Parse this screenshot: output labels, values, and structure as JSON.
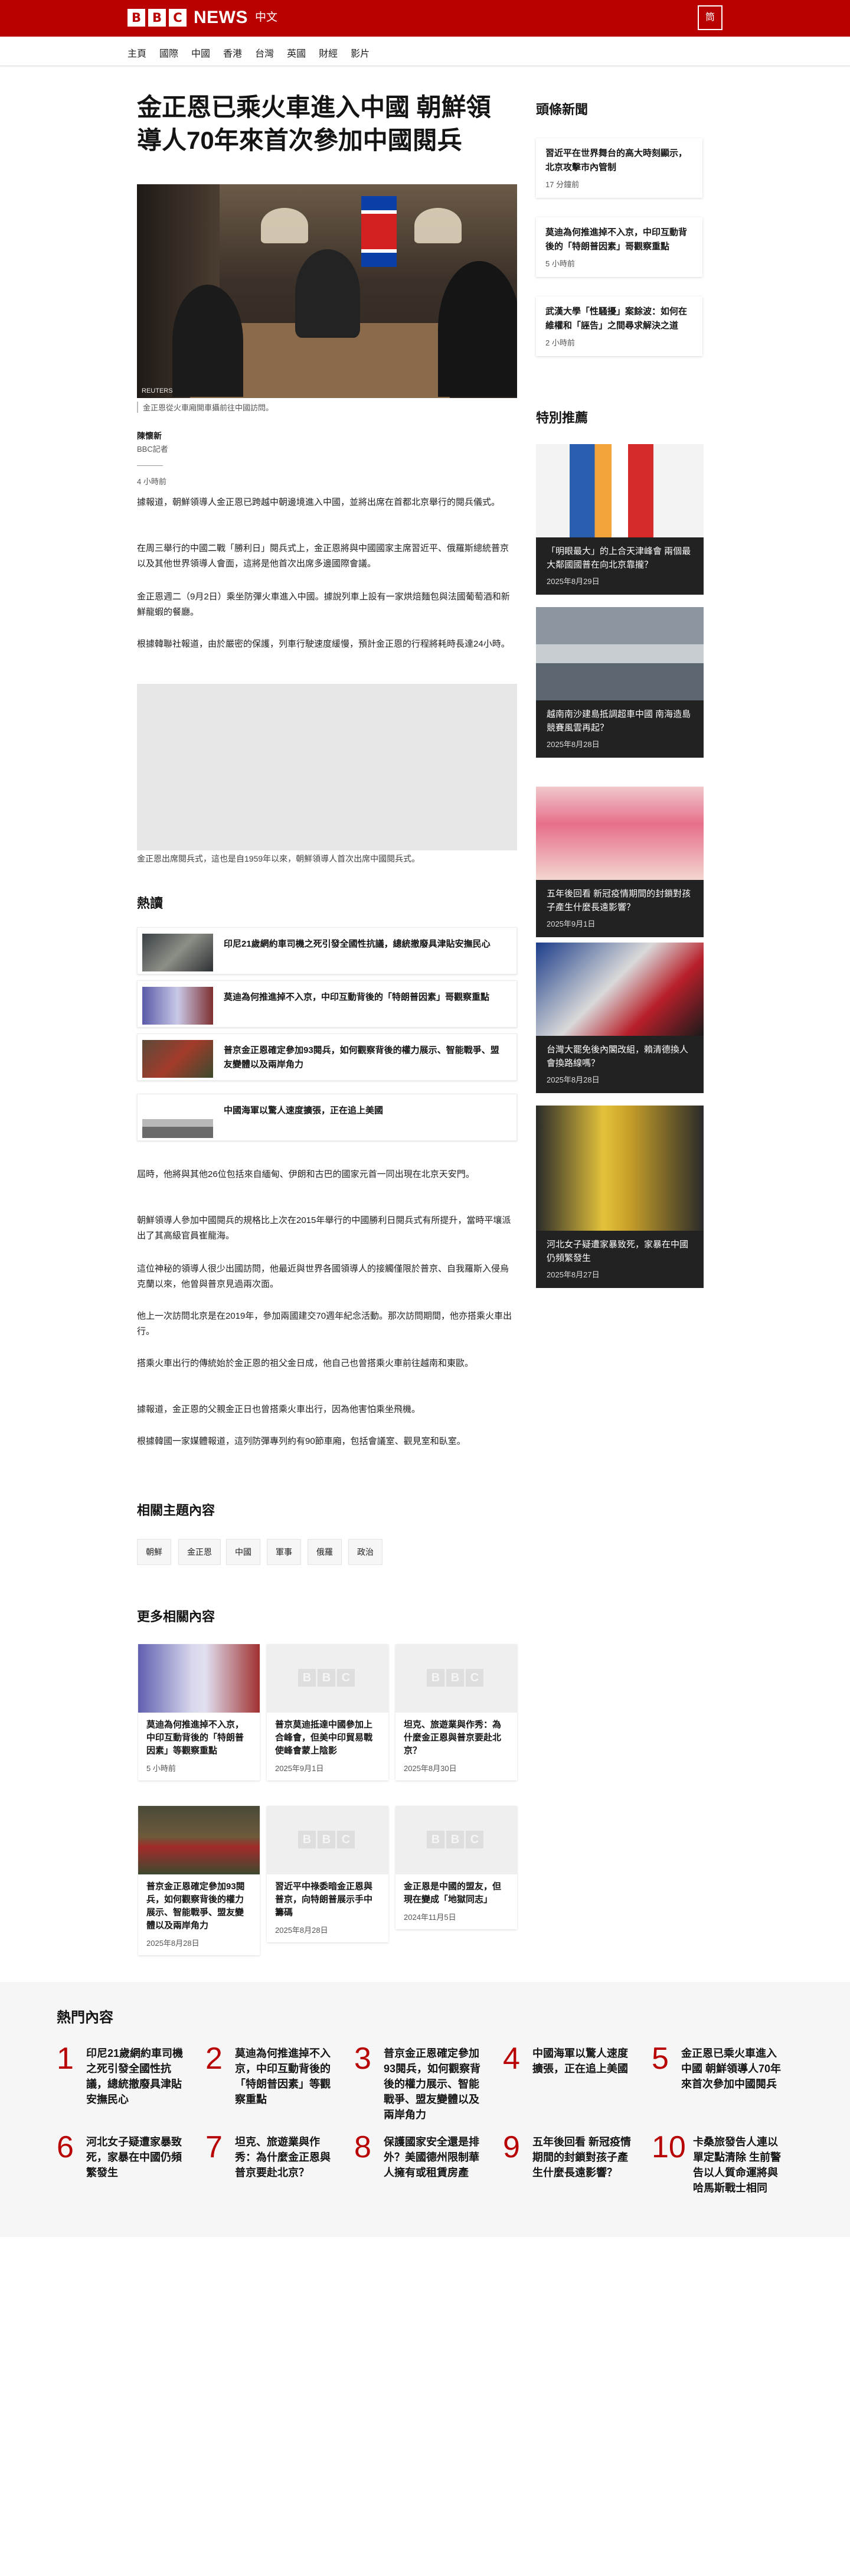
{
  "header": {
    "logo_letters": [
      "B",
      "B",
      "C"
    ],
    "brand": "NEWS",
    "lang": "中文",
    "menu_label": "筒"
  },
  "nav": {
    "items": [
      "主頁",
      "國際",
      "中國",
      "香港",
      "台灣",
      "英國",
      "財經",
      "影片"
    ]
  },
  "article": {
    "title": "金正恩已乘火車進入中國 朝鮮領導人70年來首次參加中國閱兵",
    "image_credit": "REUTERS",
    "image_caption": "金正恩從火車廂開車攝前往中國訪問。",
    "author": "陳懷新",
    "role": "BBC記者",
    "time": "4 小時前",
    "paras_top": [
      "據報道，朝鮮領導人金正恩已跨越中朝邊境進入中國，並將出席在首都北京舉行的閱兵儀式。",
      "在周三舉行的中國二戰「勝利日」閱兵式上，金正恩將與中國國家主席習近平、俄羅斯總統普京以及其他世界領導人會面，這將是他首次出席多邊國際會議。",
      "金正恩週二（9月2日）乘坐防彈火車進入中國。據說列車上設有一家烘焙麵包與法國葡萄酒和新鮮龍蝦的餐廳。",
      "根據韓聯社報道，由於嚴密的保護，列車行駛速度緩慢，預計金正恩的行程將耗時長達24小時。"
    ],
    "media_caption": "金正恩出席閱兵式，這也是自1959年以來，朝鮮領導人首次出席中國閱兵式。",
    "paras_bottom": [
      "屆時，他將與其他26位包括來自緬甸、伊朗和古巴的國家元首一同出現在北京天安門。",
      "朝鮮領導人參加中國閱兵的規格比上次在2015年舉行的中國勝利日閱兵式有所提升，當時平壤派出了其高級官員崔龍海。",
      "這位神秘的領導人很少出國訪問，他最近與世界各國領導人的接觸僅限於普京、自我羅斯入侵烏克蘭以來，他曾與普京見過兩次面。",
      "他上一次訪問北京是在2019年，參加兩國建交70週年紀念活動。那次訪問期間，他亦搭乘火車出行。",
      "搭乘火車出行的傳統始於金正恩的祖父金日成，他自己也曾搭乘火車前往越南和東歐。",
      "據報道，金正恩的父親金正日也曾搭乘火車出行，因為他害怕乘坐飛機。",
      "根據韓國一家媒體報道，這列防彈專列約有90節車廂，包括會議室、觀見室和臥室。"
    ]
  },
  "hot_section": {
    "heading": "熱讀",
    "items": [
      "印尼21歲網約車司機之死引發全國性抗議，總統撤廢具津貼安撫民心",
      "莫迪為何推進掉不入京，中印互動背後的「特朗普因素」哥觀察重點",
      "普京金正恩確定參加93閱兵，如何觀察背後的權力展示、智能戰爭、盟友變體以及兩岸角力",
      "中國海軍以驚人速度擴張，正在追上美國"
    ]
  },
  "topics": {
    "heading": "相關主題內容",
    "tags": [
      "朝鮮",
      "金正恩",
      "中國",
      "軍事",
      "俄羅",
      "政治"
    ]
  },
  "more": {
    "heading": "更多相關內容",
    "cards": [
      {
        "title": "莫迪為何推進掉不入京，中印互動背後的「特朗普因素」等觀察重點",
        "date": "5 小時前"
      },
      {
        "title": "普京莫迪抵達中國參加上合峰會，但美中印貿易戰使峰會蒙上陰影",
        "date": "2025年9月1日"
      },
      {
        "title": "坦克、旅遊業與作秀：為什麼金正恩與普京要赴北京？",
        "date": "2025年8月30日"
      },
      {
        "title": "普京金正恩確定參加93閱兵，如何觀察背後的權力展示、智能戰爭、盟友變體以及兩岸角力",
        "date": "2025年8月28日"
      },
      {
        "title": "習近平中祿委暗金正恩與普京，向特朗普展示手中籌碼",
        "date": "2025年8月28日"
      },
      {
        "title": "金正恩是中國的盟友，但現在變成「地獄同志」",
        "date": "2024年11月5日"
      }
    ],
    "placeholder_letters": [
      "B",
      "B",
      "C"
    ]
  },
  "sidebar": {
    "top_heading": "頭條新聞",
    "top_stories": [
      {
        "title": "習近平在世界舞台的高大時刻顯示，北京攻擊市內管制",
        "date": "17 分鐘前"
      },
      {
        "title": "莫迪為何推進掉不入京，中印互動背後的「特朗普因素」哥觀察重點",
        "date": "5 小時前"
      },
      {
        "title": "武漢大學「性騷擾」案餘波：如何在維權和「誣告」之間尋求解決之道",
        "date": "2 小時前"
      }
    ],
    "feature_heading": "特別推薦",
    "features": [
      {
        "title": "「明眼最大」的上合天津峰會 兩個最大鄰國國普在向北京靠攏？",
        "date": "2025年8月29日"
      },
      {
        "title": "越南南沙建島抵調超車中國 南海造島競賽風雲再起？",
        "date": "2025年8月28日"
      },
      {
        "title": "五年後回看 新冠疫情期間的封鎖對孩子產生什麼長遠影響？",
        "date": "2025年9月1日"
      },
      {
        "title": "台灣大罷免後內閣改組，賴清德換人會換路線嗎？",
        "date": "2025年8月28日"
      },
      {
        "title": "河北女子疑遭家暴致死，家暴在中國仍頻繁發生",
        "date": "2025年8月27日"
      }
    ]
  },
  "most_read": {
    "heading": "熱門內容",
    "items": [
      {
        "n": "1",
        "t": "印尼21歲網約車司機之死引發全國性抗議，總統撤廢具津貼安撫民心"
      },
      {
        "n": "2",
        "t": "莫迪為何推進掉不入京，中印互動背後的「特朗普因素」等觀察重點"
      },
      {
        "n": "3",
        "t": "普京金正恩確定參加93閱兵，如何觀察背後的權力展示、智能戰爭、盟友變體以及兩岸角力"
      },
      {
        "n": "4",
        "t": "中國海軍以驚人速度擴張，正在追上美國"
      },
      {
        "n": "5",
        "t": "金正恩已乘火車進入中國 朝鮮領導人70年來首次參加中國閱兵"
      },
      {
        "n": "6",
        "t": "河北女子疑遭家暴致死，家暴在中國仍頻繁發生"
      },
      {
        "n": "7",
        "t": "坦克、旅遊業與作秀：為什麼金正恩與普京要赴北京？"
      },
      {
        "n": "8",
        "t": "保護國家安全還是排外？美國德州限制華人擁有或租賃房產"
      },
      {
        "n": "9",
        "t": "五年後回看 新冠疫情期間的封鎖對孩子產生什麼長遠影響？"
      },
      {
        "n": "10",
        "t": "卡桑旅發告人連以單定點清除 生前警告以人質命運將與哈馬斯戰士相同"
      }
    ]
  },
  "colors": {
    "brand_red": "#b80000",
    "page_bg": "#ffffff",
    "footer_bg": "#f6f6f6"
  }
}
